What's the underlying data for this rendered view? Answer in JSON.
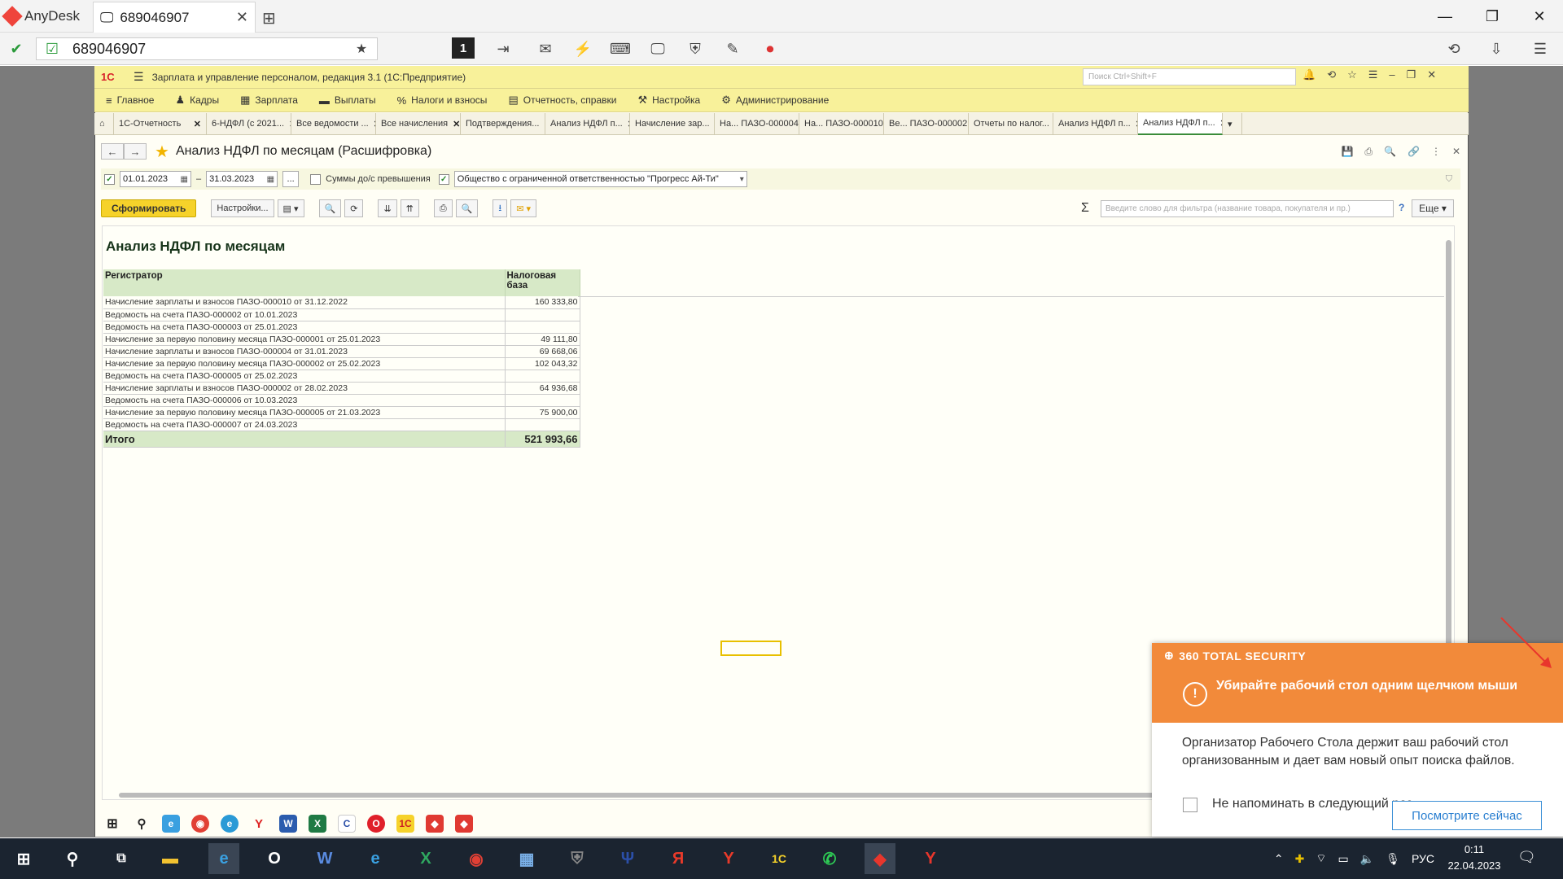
{
  "anydesk": {
    "app_name": "AnyDesk",
    "tab_label": "689046907",
    "address": "689046907",
    "monitor": "1"
  },
  "c1": {
    "title": "Зарплата и управление персоналом, редакция 3.1  (1С:Предприятие)",
    "logo": "1С",
    "search_placeholder": "Поиск Ctrl+Shift+F",
    "sections": [
      {
        "icon": "≡",
        "label": "Главное"
      },
      {
        "icon": "♟",
        "label": "Кадры"
      },
      {
        "icon": "▦",
        "label": "Зарплата"
      },
      {
        "icon": "▬",
        "label": "Выплаты"
      },
      {
        "icon": "%",
        "label": "Налоги и взносы"
      },
      {
        "icon": "▤",
        "label": "Отчетность, справки"
      },
      {
        "icon": "⚒",
        "label": "Настройка"
      },
      {
        "icon": "⚙",
        "label": "Администрирование"
      }
    ],
    "tabs": [
      "1С-Отчетность",
      "6-НДФЛ (с 2021...",
      "Все ведомости ...",
      "Все начисления",
      "Подтверждения...",
      "Анализ НДФЛ п...",
      "Начисление зар...",
      "На... ПАЗО-000004",
      "На... ПАЗО-000010",
      "Ве... ПАЗО-000002",
      "Отчеты по налог...",
      "Анализ НДФЛ п...",
      "Анализ НДФЛ п..."
    ]
  },
  "form": {
    "title": "Анализ НДФЛ по месяцам (Расшифровка)",
    "date_from": "01.01.2023",
    "date_to": "31.03.2023",
    "dash": "–",
    "ellipsis": "...",
    "sums_label": "Суммы до/с превышения",
    "org": "Общество с ограниченной ответственностью \"Прогресс Ай-Ти\"",
    "generate": "Сформировать",
    "settings": "Настройки...",
    "filter_placeholder": "Введите слово для фильтра (название товара, покупателя и пр.)",
    "help": "?",
    "more": "Еще"
  },
  "report": {
    "title": "Анализ НДФЛ по месяцам",
    "col1": "Регистратор",
    "col2": "Налоговая база",
    "rows": [
      {
        "reg": "Начисление зарплаты и взносов ПАЗО-000010 от 31.12.2022",
        "base": "160 333,80"
      },
      {
        "reg": "Ведомость на счета ПАЗО-000002 от 10.01.2023",
        "base": ""
      },
      {
        "reg": "Ведомость на счета ПАЗО-000003 от 25.01.2023",
        "base": ""
      },
      {
        "reg": "Начисление за первую половину месяца ПАЗО-000001 от 25.01.2023",
        "base": "49 111,80"
      },
      {
        "reg": "Начисление зарплаты и взносов ПАЗО-000004 от 31.01.2023",
        "base": "69 668,06"
      },
      {
        "reg": "Начисление за первую половину месяца ПАЗО-000002 от 25.02.2023",
        "base": "102 043,32"
      },
      {
        "reg": "Ведомость на счета ПАЗО-000005 от 25.02.2023",
        "base": ""
      },
      {
        "reg": "Начисление зарплаты и взносов ПАЗО-000002 от 28.02.2023",
        "base": "64 936,68"
      },
      {
        "reg": "Ведомость на счета ПАЗО-000006 от 10.03.2023",
        "base": ""
      },
      {
        "reg": "Начисление за первую половину месяца ПАЗО-000005 от 21.03.2023",
        "base": "75 900,00"
      },
      {
        "reg": "Ведомость на счета ПАЗО-000007 от 24.03.2023",
        "base": ""
      }
    ],
    "total_label": "Итого",
    "total_value": "521 993,66"
  },
  "notification": {
    "brand": "360 TOTAL SECURITY",
    "title": "Убирайте рабочий стол одним щелчком мыши",
    "text": "Организатор Рабочего Стола держит ваш рабочий стол организованным и дает вам новый опыт поиска файлов.",
    "checkbox_label": "Не напоминать в следующий раз",
    "button": "Посмотрите сейчас",
    "accent_color": "#f28a3a"
  },
  "taskbar": {
    "lang": "РУС",
    "time": "0:11",
    "date": "22.04.2023"
  }
}
